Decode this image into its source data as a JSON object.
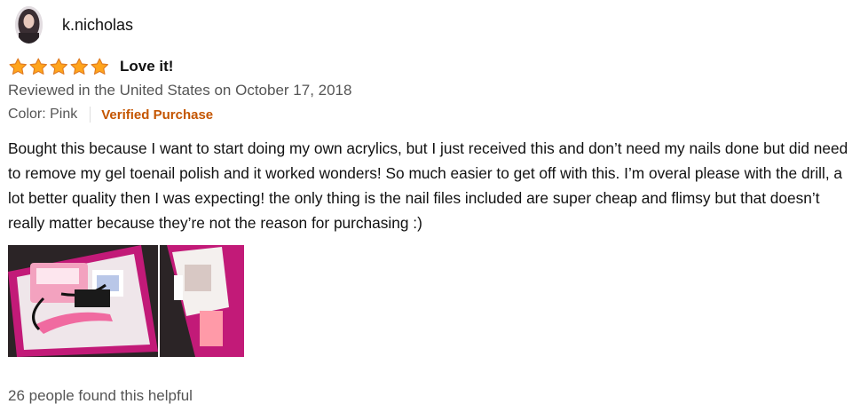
{
  "review": {
    "username": "k.nicholas",
    "rating": 5,
    "rating_max": 5,
    "title": "Love it!",
    "date_line": "Reviewed in the United States on October 17, 2018",
    "variant": "Color: Pink",
    "verified_label": "Verified Purchase",
    "body": "Bought this because I want to start doing my own acrylics, but I just received this and don’t need my nails done but did need to remove my gel toenail polish and it worked wonders! So much easier to get off with this. I’m overal please with the drill, a lot better quality then I was expecting! the only thing is the nail files included are super cheap and flimsy but that doesn’t really matter because they’re not the reason for purchasing :)",
    "helpful_text": "26 people found this helpful",
    "photos": [
      {
        "icon": "review-photo-nail-drill-box"
      },
      {
        "icon": "review-photo-nail-drill-package"
      }
    ]
  },
  "colors": {
    "star_fill": "#ffa41c",
    "star_stroke": "#de7921",
    "verified": "#c45500",
    "secondary_text": "#555555",
    "photo_magenta": "#c21a78"
  }
}
